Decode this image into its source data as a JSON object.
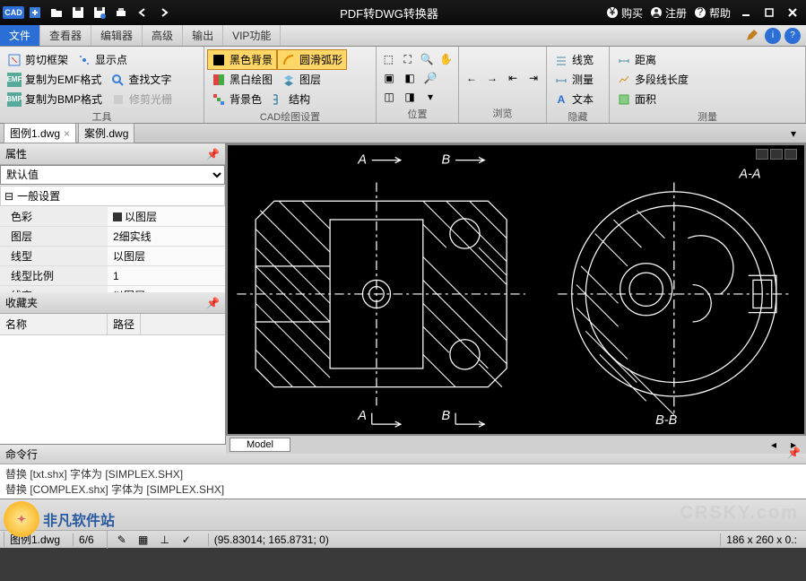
{
  "titlebar": {
    "app_logo": "CAD",
    "title": "PDF转DWG转换器",
    "buy_label": "购买",
    "register_label": "注册",
    "help_label": "帮助"
  },
  "menu": {
    "tabs": [
      "文件",
      "查看器",
      "编辑器",
      "高级",
      "输出",
      "VIP功能"
    ],
    "active_index": 0
  },
  "ribbon": {
    "tools": {
      "title": "工具",
      "btn_clip": "剪切框架",
      "btn_emf": "复制为EMF格式",
      "btn_bmp": "复制为BMP格式",
      "btn_showpt": "显示点",
      "btn_findtxt": "查找文字",
      "btn_trimlight": "修剪光栅"
    },
    "cad_settings": {
      "title": "CAD绘图设置",
      "btn_blackbg": "黑色背景",
      "btn_roundarc": "圆滑弧形",
      "btn_bwdraw": "黑白绘图",
      "btn_layer": "图层",
      "btn_bgcolor": "背景色",
      "btn_struct": "结构"
    },
    "position": {
      "title": "位置"
    },
    "browse": {
      "title": "浏览"
    },
    "hide": {
      "title": "隐藏",
      "btn_lw": "线宽",
      "btn_meas": "测量",
      "btn_text": "文本"
    },
    "measure": {
      "title": "测量",
      "btn_dist": "距离",
      "btn_polylen": "多段线长度",
      "btn_area": "面积"
    }
  },
  "doc_tabs": {
    "tabs": [
      {
        "name": "图例1.dwg",
        "active": true
      },
      {
        "name": "案例.dwg",
        "active": false
      }
    ]
  },
  "properties_panel": {
    "title": "属性",
    "default_label": "默认值",
    "section": "一般设置",
    "rows": [
      {
        "k": "色彩",
        "v": "以图层",
        "swatch": true
      },
      {
        "k": "图层",
        "v": "2细实线"
      },
      {
        "k": "线型",
        "v": "以图层"
      },
      {
        "k": "线型比例",
        "v": "1"
      },
      {
        "k": "线宽",
        "v": "以图层"
      }
    ]
  },
  "favorites_panel": {
    "title": "收藏夹",
    "col_name": "名称",
    "col_path": "路径"
  },
  "canvas": {
    "labels": {
      "a_top": "A",
      "b_top": "B",
      "a_bot": "A",
      "b_bot": "B",
      "aa": "A-A",
      "bb": "B-B"
    },
    "model_tab": "Model"
  },
  "command_panel": {
    "title": "命令行",
    "lines": [
      "替换 [txt.shx] 字体为 [SIMPLEX.SHX]",
      "替换 [COMPLEX.shx] 字体为 [SIMPLEX.SHX]"
    ]
  },
  "statusbar": {
    "file_hint": "图例1.dwg",
    "pages": "6/6",
    "coords": "(95.83014; 165.8731; 0)",
    "dims": "186 x 260 x 0.:",
    "watermark_name": "非凡软件站",
    "watermark_url": "CRSKY.com"
  }
}
